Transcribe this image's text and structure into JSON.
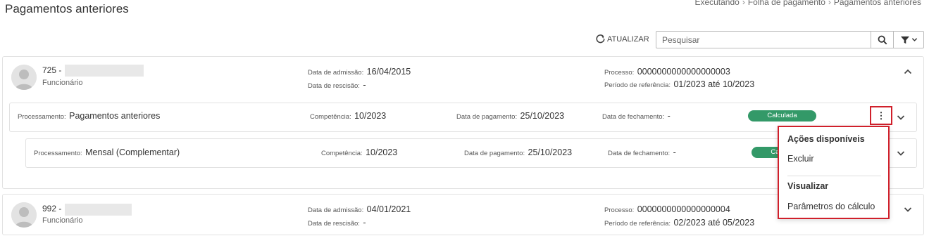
{
  "header": {
    "title": "Pagamentos anteriores",
    "breadcrumb": [
      "Executando",
      "Folha de pagamento",
      "Pagamentos anteriores"
    ]
  },
  "toolbar": {
    "refresh_label": "ATUALIZAR",
    "search_placeholder": "Pesquisar"
  },
  "labels": {
    "admissao": "Data de admissão:",
    "rescisao": "Data de rescisão:",
    "processo": "Processo:",
    "periodo": "Período de referência:",
    "processamento": "Processamento:",
    "competencia": "Competência:",
    "pagamento": "Data de pagamento:",
    "fechamento": "Data de fechamento:"
  },
  "employees": [
    {
      "id": "725 -",
      "role": "Funcionário",
      "admissao": "16/04/2015",
      "rescisao": "-",
      "processo": "0000000000000000003",
      "periodo": "01/2023 até 10/2023",
      "rows": [
        {
          "processamento": "Pagamentos anteriores",
          "competencia": "10/2023",
          "pagamento": "25/10/2023",
          "fechamento": "-",
          "status": "Calculada"
        },
        {
          "processamento": "Mensal (Complementar)",
          "competencia": "10/2023",
          "pagamento": "25/10/2023",
          "fechamento": "-",
          "status": "Calculada"
        }
      ]
    },
    {
      "id": "992 -",
      "role": "Funcionário",
      "admissao": "04/01/2021",
      "rescisao": "-",
      "processo": "0000000000000000004",
      "periodo": "02/2023 até 05/2023"
    }
  ],
  "menu": {
    "section1": "Ações disponíveis",
    "item1": "Excluir",
    "section2": "Visualizar",
    "item2": "Parâmetros do cálculo"
  },
  "colors": {
    "status_green": "#339968",
    "highlight_red": "#d0202b"
  }
}
